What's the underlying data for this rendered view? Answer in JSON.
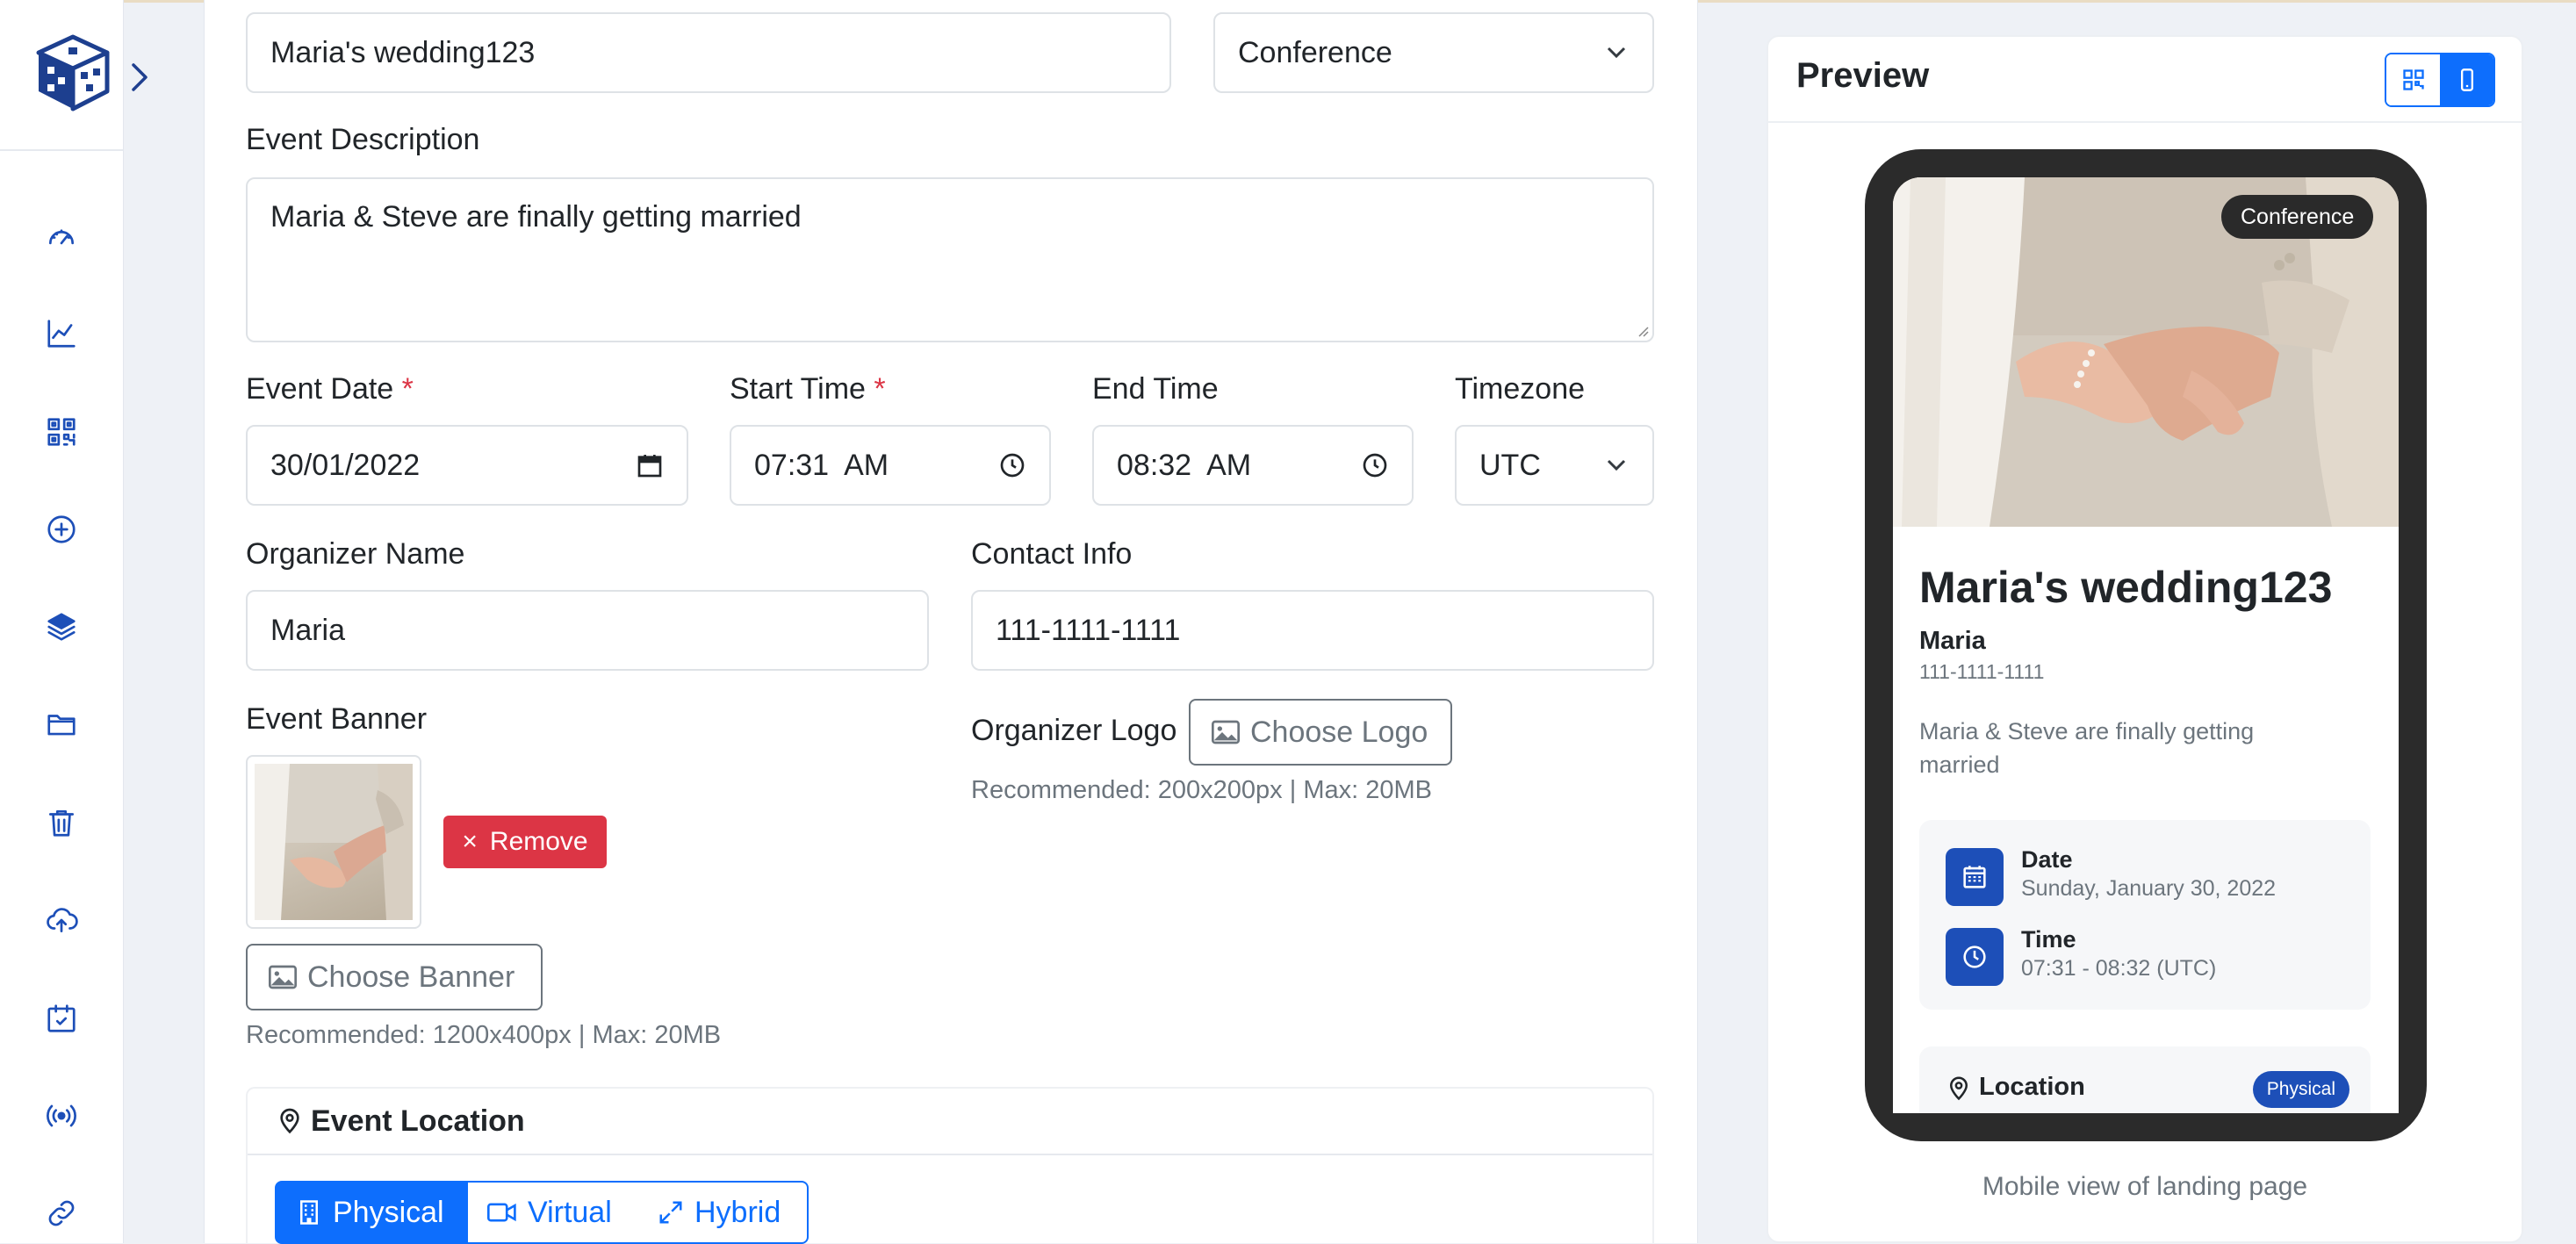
{
  "sidebar": {
    "items": [
      {
        "icon": "speedometer-icon"
      },
      {
        "icon": "line-chart-icon"
      },
      {
        "icon": "qr-code-icon"
      },
      {
        "icon": "plus-circle-icon"
      },
      {
        "icon": "layers-icon"
      },
      {
        "icon": "folder-icon"
      },
      {
        "icon": "trash-icon"
      },
      {
        "icon": "cloud-upload-icon"
      },
      {
        "icon": "calendar-check-icon"
      },
      {
        "icon": "broadcast-icon"
      },
      {
        "icon": "link-icon"
      }
    ]
  },
  "form": {
    "event_name_value": "Maria's wedding123",
    "event_type_value": "Conference",
    "description_label": "Event Description",
    "description_value": "Maria & Steve are finally getting married",
    "date_label": "Event Date",
    "date_value": "30/01/2022",
    "start_label": "Start Time",
    "start_value": "07:31  AM",
    "end_label": "End Time",
    "end_value": "08:32  AM",
    "timezone_label": "Timezone",
    "timezone_value": "UTC",
    "required_mark": "*",
    "organizer_label": "Organizer Name",
    "organizer_value": "Maria",
    "contact_label": "Contact Info",
    "contact_value": "111-1111-1111",
    "banner_label": "Event Banner",
    "remove_label": "Remove",
    "remove_glyph": "×",
    "choose_banner_label": "Choose Banner",
    "banner_hint": "Recommended: 1200x400px | Max: 20MB",
    "logo_label": "Organizer Logo",
    "choose_logo_label": "Choose Logo",
    "logo_hint": "Recommended: 200x200px | Max: 20MB",
    "location_heading": "Event Location",
    "location_types": [
      "Physical",
      "Virtual",
      "Hybrid"
    ],
    "location_selected": "Physical"
  },
  "preview": {
    "title": "Preview",
    "badge": "Conference",
    "event_title": "Maria's wedding123",
    "organizer": "Maria",
    "contact": "111-1111-1111",
    "description": "Maria & Steve are finally getting married",
    "date_label": "Date",
    "date_value": "Sunday, January 30, 2022",
    "time_label": "Time",
    "time_value": "07:31 - 08:32 (UTC)",
    "location_label": "Location",
    "location_badge": "Physical",
    "caption": "Mobile view of landing page"
  },
  "colors": {
    "brand_blue": "#1d4fb8",
    "primary": "#0d6efd",
    "danger": "#dc3545",
    "muted": "#6c757d"
  }
}
